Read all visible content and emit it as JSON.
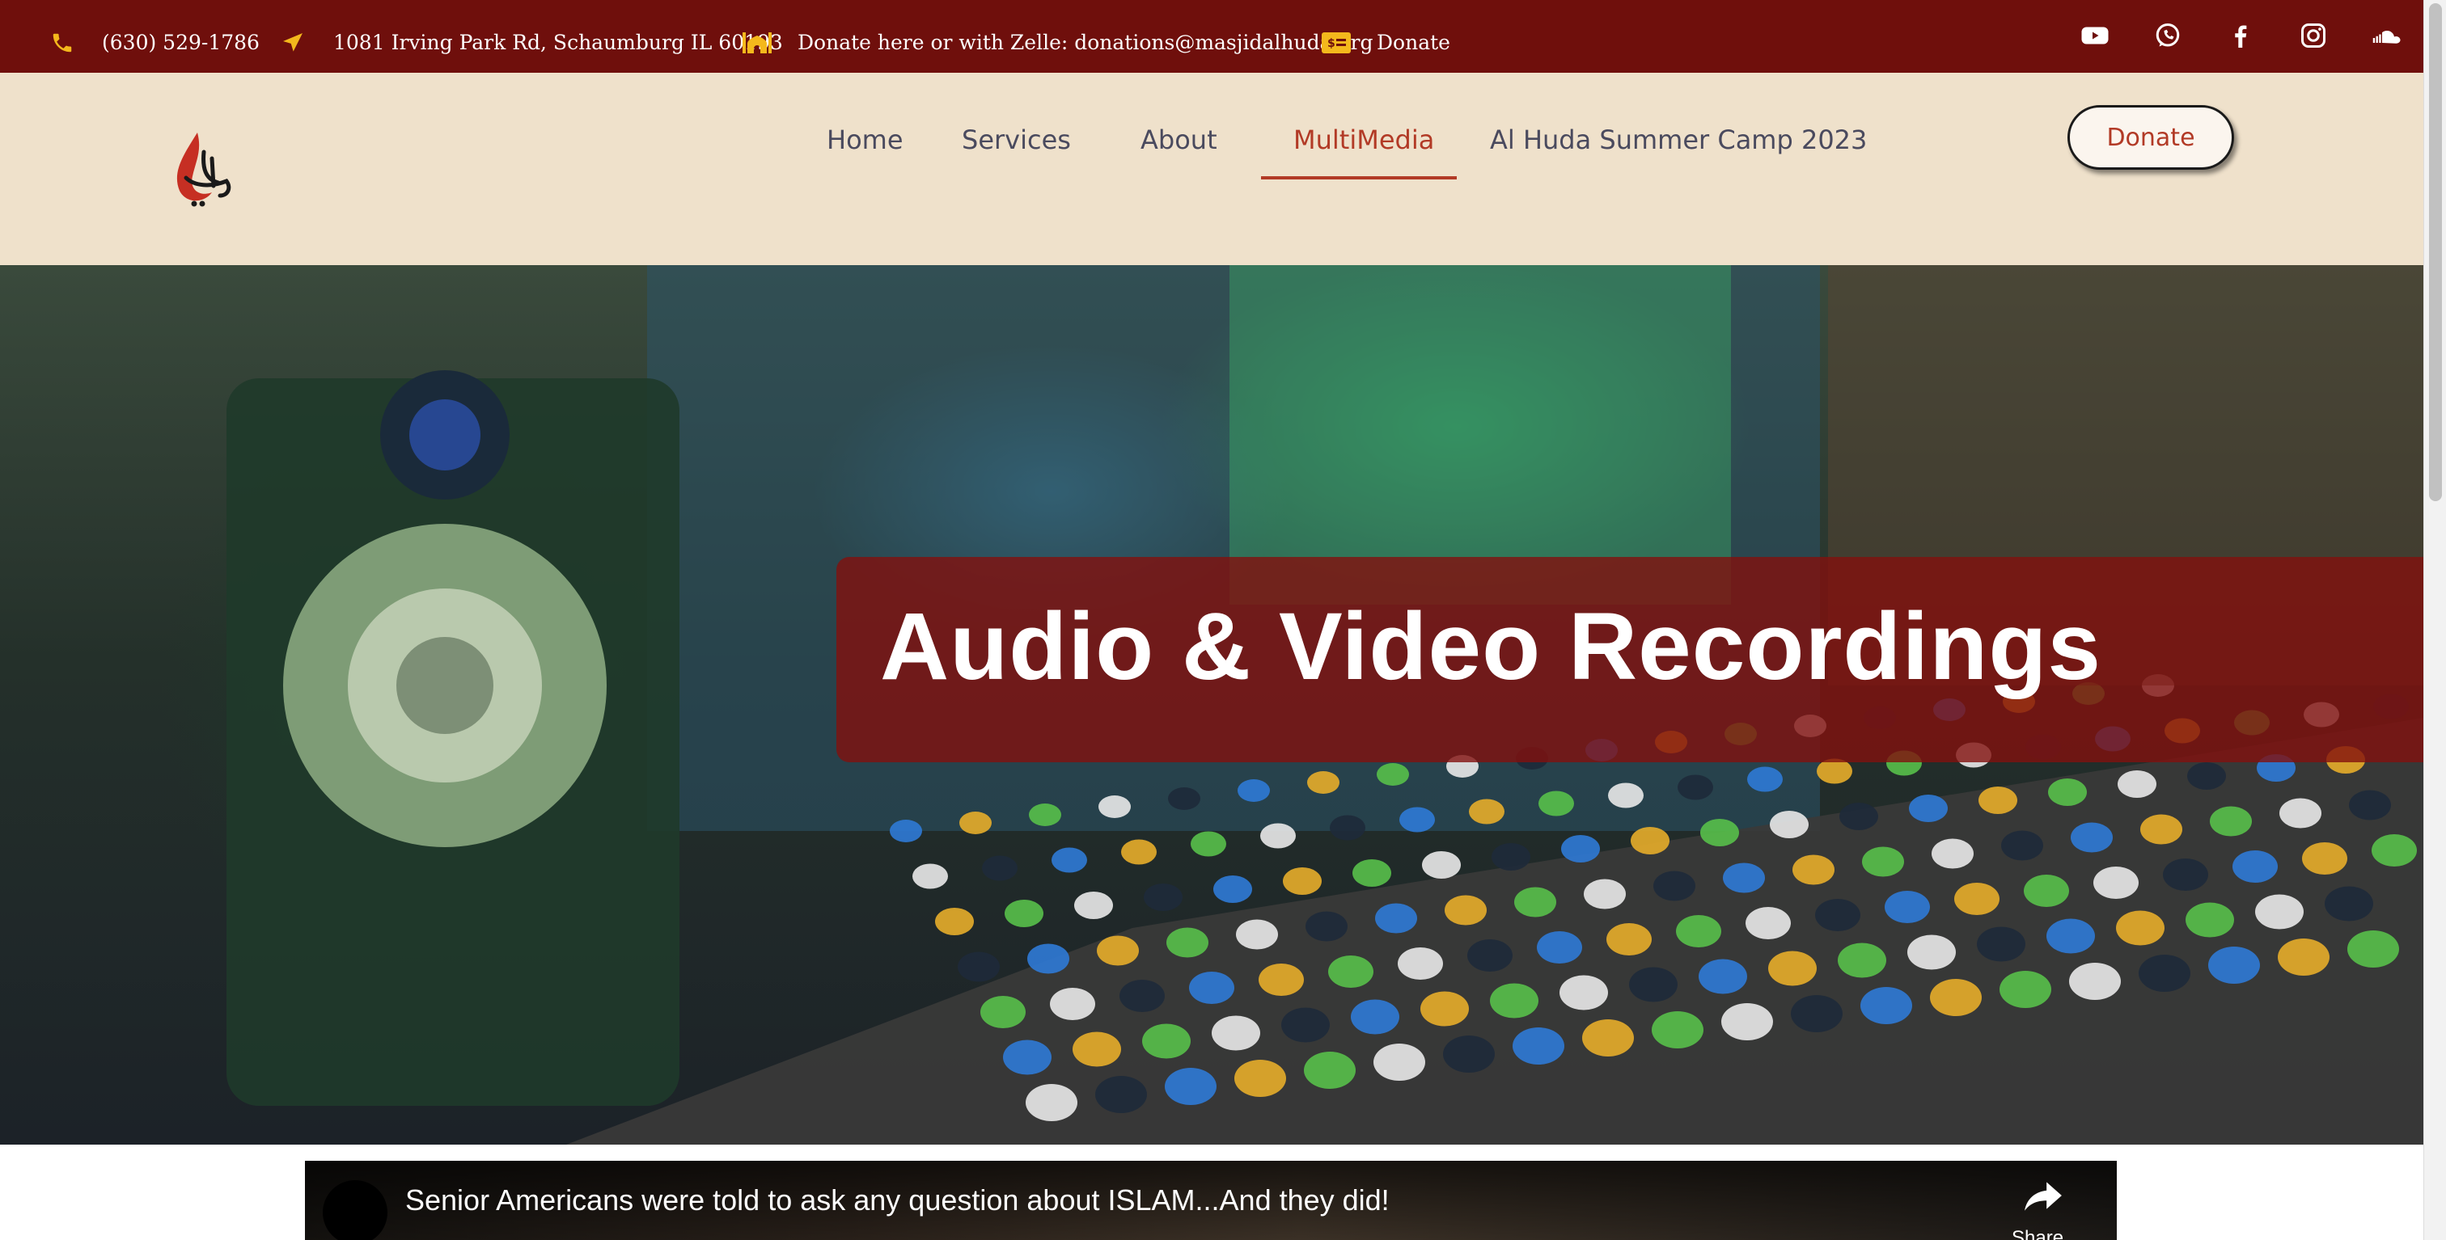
{
  "topbar": {
    "phone": "(630) 529-1786",
    "address": "1081 Irving Park Rd, Schaumburg IL 60193",
    "zelle": "Donate here or with Zelle: donations@masjidalhuda.org",
    "donate_link": "Donate",
    "social": [
      "youtube-icon",
      "whatsapp-icon",
      "facebook-icon",
      "instagram-icon",
      "soundcloud-icon"
    ]
  },
  "nav": {
    "items": [
      {
        "label": "Home"
      },
      {
        "label": "Services"
      },
      {
        "label": "About"
      },
      {
        "label": "MultiMedia",
        "active": true
      },
      {
        "label": "Al Huda Summer Camp 2023"
      }
    ],
    "donate_button": "Donate"
  },
  "hero": {
    "title": "Audio & Video Recordings"
  },
  "video": {
    "title": "Senior Americans were told to ask any question about ISLAM...And they did!",
    "share_label": "Share"
  },
  "colors": {
    "topbar_bg": "#6f0f0c",
    "header_bg": "#efe1cb",
    "accent": "#b23a26",
    "icon_gold": "#f4b81c",
    "nav_text": "#4a4a5e"
  }
}
